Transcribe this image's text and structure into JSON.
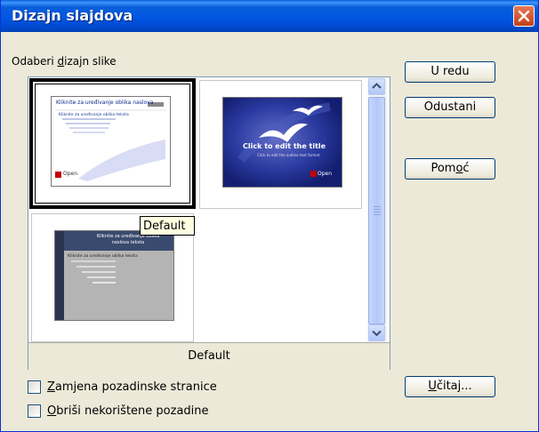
{
  "window": {
    "title": "Dizajn slajdova"
  },
  "gallery": {
    "label_pre": "Odaberi ",
    "label_ul": "d",
    "label_post": "izajn slike",
    "caption": "Default",
    "tooltip": "Default",
    "thumb1": {
      "title": "Kliknite za uređivanje oblika naslova",
      "l1": "Kliknite za uređivanje oblika teksta",
      "logo": "Open"
    },
    "thumb2": {
      "title": "Click to edit the title",
      "sub": "Click to edit the outline text format",
      "logo": "Open"
    },
    "thumb3": {
      "title": "Kliknite za uređivanje oblika naslova teksta",
      "l1": "Kliknite za uređivanje oblika teksta"
    }
  },
  "buttons": {
    "ok": "U redu",
    "cancel": "Odustani",
    "help_pre": "Pom",
    "help_ul": "o",
    "help_post": "ć",
    "load_ul": "U",
    "load_post": "čitaj..."
  },
  "options": {
    "replace_ul": "Z",
    "replace_post": "amjena pozadinske stranice",
    "delete_ul": "O",
    "delete_post": "briši nekorištene pozadine",
    "replace_checked": false,
    "delete_checked": false
  },
  "colors": {
    "titlebar": "#0054e3",
    "slide2_bg": "#1c2a8c"
  }
}
